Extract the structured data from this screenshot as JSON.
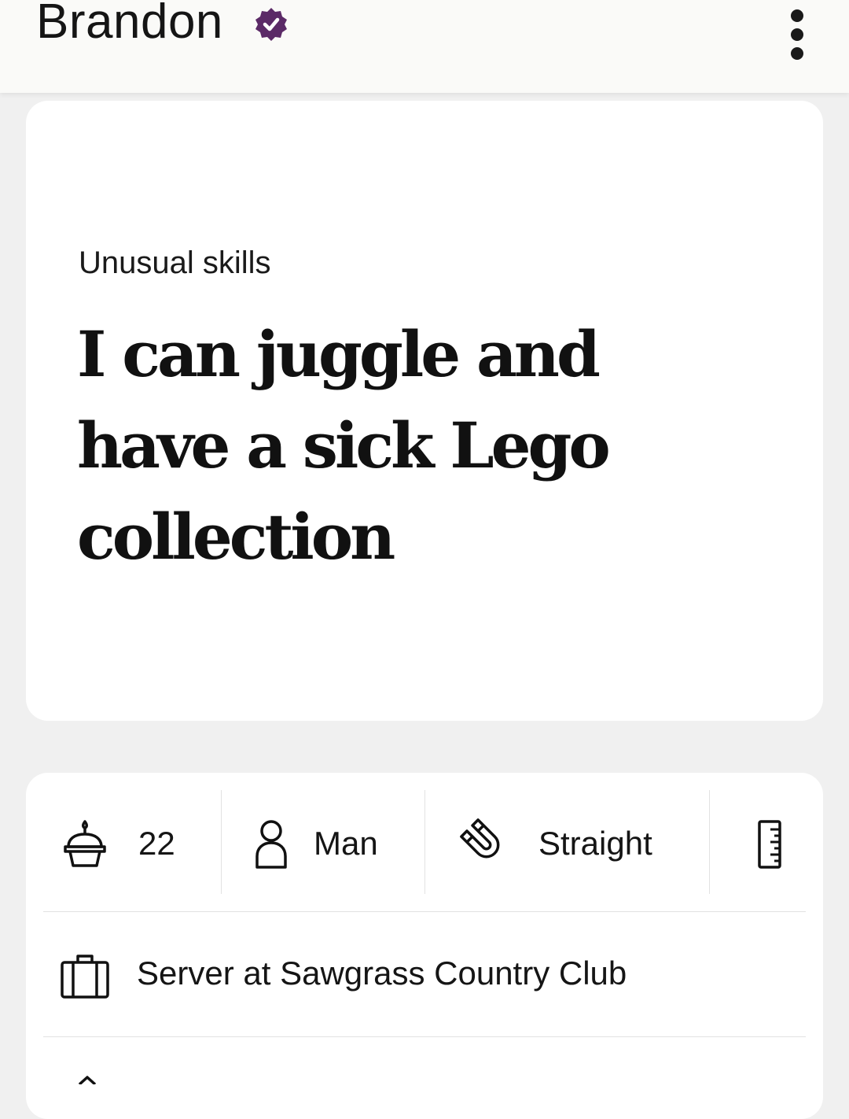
{
  "header": {
    "name": "Brandon",
    "verified_icon": "verified-badge-icon",
    "more_icon": "more-vertical-icon",
    "badge_color": "#5b2a67"
  },
  "prompt": {
    "label": "Unusual skills",
    "answer": "I can juggle and have a sick Lego collection"
  },
  "vitals": [
    {
      "icon": "birthday-cake-icon",
      "value": "22"
    },
    {
      "icon": "person-icon",
      "value": "Man"
    },
    {
      "icon": "magnet-icon",
      "value": "Straight"
    },
    {
      "icon": "ruler-icon",
      "value": ""
    }
  ],
  "job": {
    "icon": "briefcase-icon",
    "text": "Server at Sawgrass Country Club"
  }
}
